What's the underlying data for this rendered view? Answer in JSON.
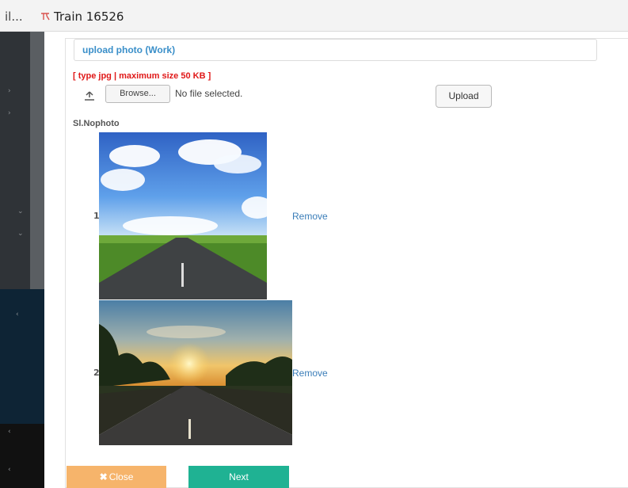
{
  "tabs": {
    "previous_label": "il...",
    "current_label": "Train 16526",
    "current_icon": "train-icon"
  },
  "section": {
    "title": "upload photo (Work)",
    "hint": "[ type jpg | maximum size 50 KB ]"
  },
  "file_input": {
    "browse_label": "Browse...",
    "status": "No file selected.",
    "upload_icon": "upload-icon"
  },
  "upload_button": "Upload",
  "table": {
    "column_header": "Sl.Nophoto",
    "rows": [
      {
        "no": "1",
        "photo": "road-blue-sky",
        "action": "Remove"
      },
      {
        "no": "2",
        "photo": "road-sunset",
        "action": "Remove"
      }
    ]
  },
  "footer": {
    "close_label": "Close",
    "close_icon": "close-icon",
    "next_label": "Next"
  },
  "colors": {
    "section_title": "#3a8fc9",
    "hint": "#e01818",
    "link": "#3a7db8",
    "close_button": "#f6b46b",
    "next_button": "#1fb293"
  }
}
